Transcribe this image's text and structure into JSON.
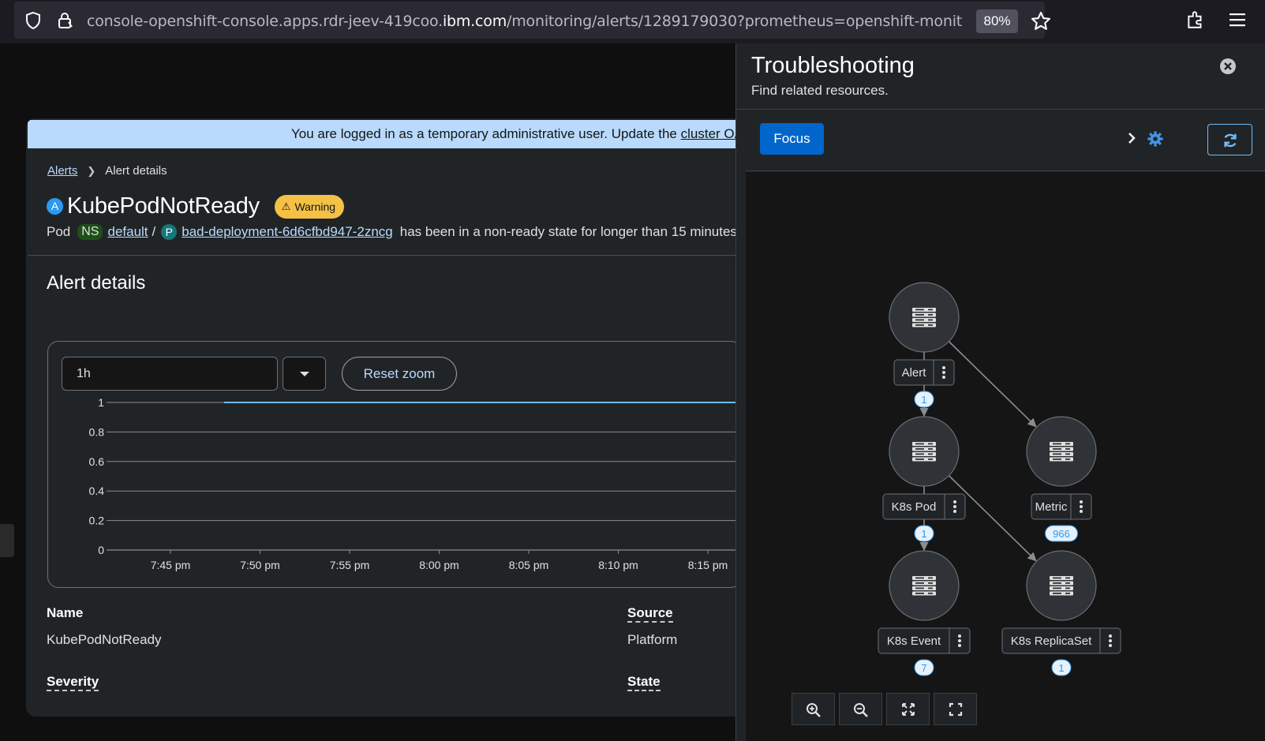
{
  "browser": {
    "url_prefix": "console-openshift-console.apps.rdr-jeev-419coo.",
    "url_host": "ibm.com",
    "url_path": "/monitoring/alerts/1289179030?prometheus=openshift-monit",
    "zoom": "80%"
  },
  "banner": {
    "text": "You are logged in as a temporary administrative user. Update the ",
    "link": "cluster OA"
  },
  "breadcrumb": {
    "root": "Alerts",
    "current": "Alert details"
  },
  "alert": {
    "badge": "A",
    "name": "KubePodNotReady",
    "severity_badge": "Warning",
    "desc_prefix": "Pod",
    "ns_badge": "NS",
    "namespace": "default",
    "slash": "/",
    "pod_badge": "P",
    "pod": "bad-deployment-6d6cfbd947-2zncg",
    "desc_suffix": "has been in a non-ready state for longer than 15 minutes"
  },
  "section_title": "Alert details",
  "chart_controls": {
    "range": "1h",
    "reset": "Reset zoom"
  },
  "chart_data": {
    "type": "line",
    "x": [
      "7:45 pm",
      "7:50 pm",
      "7:55 pm",
      "8:00 pm",
      "8:05 pm",
      "8:10 pm",
      "8:15 pm"
    ],
    "y_ticks": [
      "1",
      "0.8",
      "0.6",
      "0.4",
      "0.2",
      "0"
    ],
    "ylim": [
      0,
      1
    ],
    "series": [
      {
        "start": "7:48 pm",
        "value": 1,
        "color": "#73bcf7"
      }
    ],
    "grid": true
  },
  "details": {
    "name_label": "Name",
    "name_value": "KubePodNotReady",
    "source_label": "Source",
    "source_value": "Platform",
    "severity_label": "Severity",
    "state_label": "State"
  },
  "drawer": {
    "title": "Troubleshooting",
    "subtitle": "Find related resources.",
    "focus": "Focus"
  },
  "graph": {
    "nodes": [
      {
        "label": "Alert",
        "count": "1"
      },
      {
        "label": "K8s Pod",
        "count": "1"
      },
      {
        "label": "Metric",
        "count": "966"
      },
      {
        "label": "K8s Event",
        "count": "7"
      },
      {
        "label": "K8s ReplicaSet",
        "count": "1"
      }
    ]
  },
  "colors": {
    "primary": "#0066cc",
    "link": "#b9dafc",
    "warning": "#f4c145",
    "line": "#73bcf7"
  }
}
